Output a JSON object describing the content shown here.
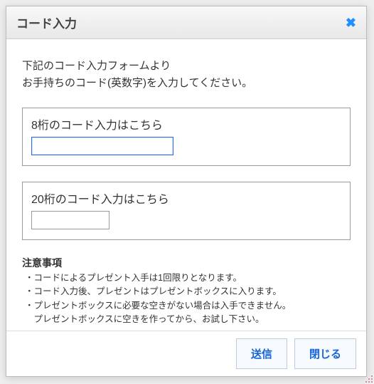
{
  "dialog": {
    "title": "コード入力",
    "instructions_line1": "下記のコード入力フォームより",
    "instructions_line2": "お手持ちのコード(英数字)を入力してください。"
  },
  "fields": {
    "code8": {
      "label": "8桁のコード入力はこちら",
      "value": ""
    },
    "code20": {
      "label": "20桁のコード入力はこちら",
      "value": ""
    }
  },
  "notes": {
    "heading": "注意事項",
    "items": [
      "コードによるプレゼント入手は1回限りとなります。",
      "コード入力後、プレゼントはプレゼントボックスに入ります。",
      "プレゼントボックスに必要な空きがない場合は入手できません。",
      "プレゼントボックスに空きを作ってから、お試し下さい。"
    ]
  },
  "buttons": {
    "submit": "送信",
    "close": "閉じる"
  },
  "colors": {
    "accent": "#1565d8",
    "close_icon": "#1e90ff"
  }
}
